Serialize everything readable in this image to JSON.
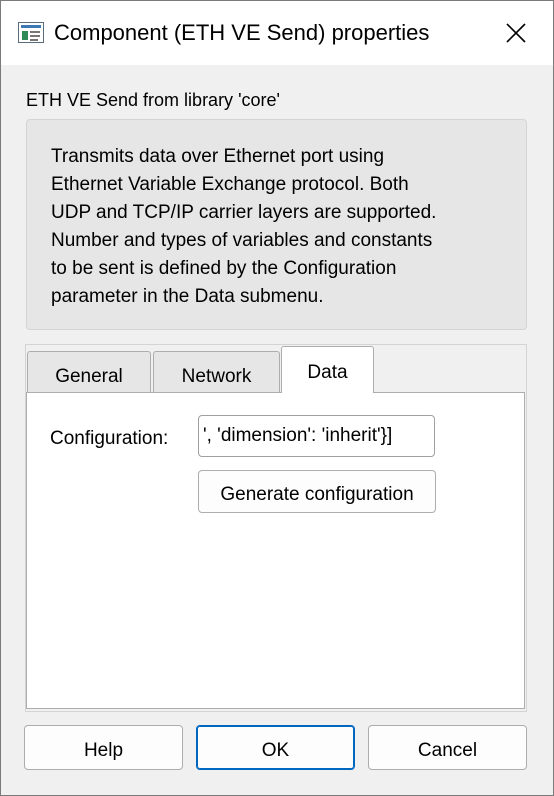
{
  "window": {
    "title": "Component (ETH VE Send) properties",
    "app_icon": "component-properties-icon",
    "close_icon": "close-icon"
  },
  "header": {
    "library_line": "ETH VE Send from library 'core'"
  },
  "description": {
    "lines": [
      "Transmits data over Ethernet port using",
      "Ethernet Variable Exchange protocol. Both",
      "UDP and TCP/IP carrier layers are supported.",
      "Number and types of variables and constants",
      "to be sent is defined by the Configuration",
      "parameter in the Data submenu."
    ]
  },
  "tabs": [
    {
      "label": "General",
      "selected": false
    },
    {
      "label": "Network",
      "selected": false
    },
    {
      "label": "Data",
      "selected": true
    }
  ],
  "data_tab": {
    "config_label": "Configuration:",
    "config_value": "', 'dimension': 'inherit'}]",
    "generate_button": "Generate configuration"
  },
  "footer": {
    "help": "Help",
    "ok": "OK",
    "cancel": "Cancel"
  },
  "colors": {
    "window_bg": "#f0f0f0",
    "titlebar_bg": "#ffffff",
    "default_button_border": "#0067c0"
  }
}
